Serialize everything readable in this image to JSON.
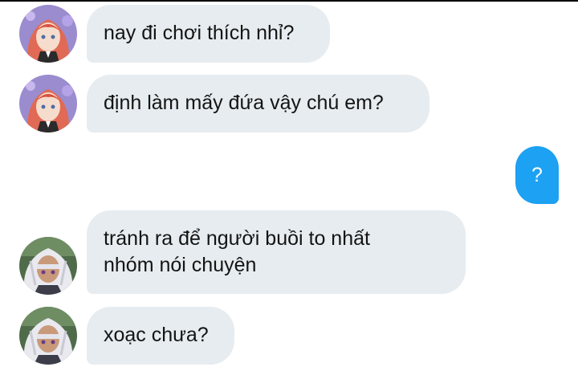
{
  "messages": [
    {
      "sender": "left",
      "avatar": "red-hair-avatar",
      "lines": [
        "nay đi chơi thích nhỉ?"
      ]
    },
    {
      "sender": "left",
      "avatar": "red-hair-avatar",
      "lines": [
        "định làm mấy đứa vậy chú em?"
      ]
    },
    {
      "sender": "right",
      "lines": [
        "?"
      ]
    },
    {
      "sender": "left",
      "avatar": "white-hair-avatar",
      "lines": [
        "tránh ra để người buồi to nhất",
        "nhóm nói chuyện"
      ]
    },
    {
      "sender": "left",
      "avatar": "white-hair-avatar",
      "lines": [
        "xoạc chưa?"
      ]
    }
  ],
  "colors": {
    "incoming_bubble": "#e6ecf0",
    "outgoing_bubble": "#1da1f2",
    "text": "#141414"
  }
}
